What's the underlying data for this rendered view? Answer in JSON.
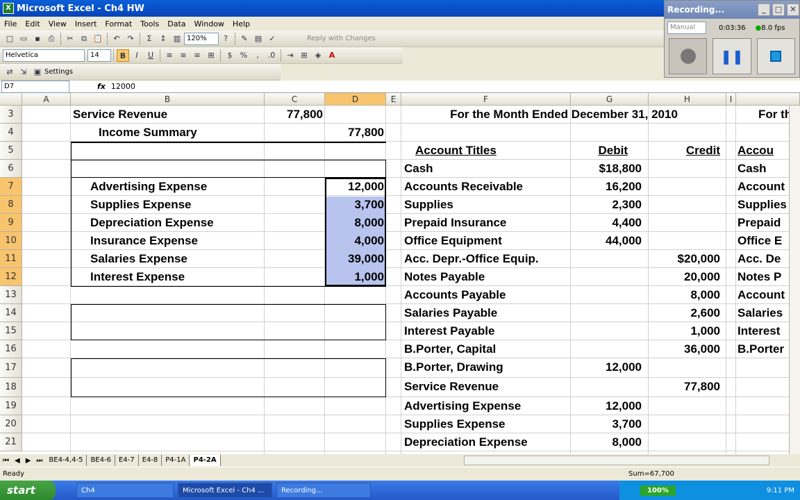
{
  "window": {
    "title": "Microsoft Excel - Ch4 HW"
  },
  "menu": [
    "File",
    "Edit",
    "View",
    "Insert",
    "Format",
    "Tools",
    "Data",
    "Window",
    "Help"
  ],
  "toolbar": {
    "zoom": "120%",
    "reply_label": "Reply with Changes",
    "font": "Helvetica",
    "font_size": "14",
    "settings_label": "Settings"
  },
  "recorder": {
    "title": "Recording...",
    "mode": "Manual",
    "time": "0:03:36",
    "fps": "8.0 fps"
  },
  "formula_bar": {
    "cell_ref": "D7",
    "fx": "fx",
    "value": "12000"
  },
  "columns": [
    "A",
    "B",
    "C",
    "D",
    "E",
    "F",
    "G",
    "H",
    "I"
  ],
  "rows": [
    "3",
    "4",
    "5",
    "6",
    "7",
    "8",
    "9",
    "10",
    "11",
    "12",
    "13",
    "14",
    "15",
    "16",
    "17",
    "18",
    "19",
    "20",
    "21"
  ],
  "left": [
    {
      "b": "Service Revenue",
      "c": "77,800",
      "d": ""
    },
    {
      "b": "Income Summary",
      "c": "",
      "d": "77,800"
    },
    {
      "b": "",
      "c": "",
      "d": ""
    },
    {
      "b": "",
      "c": "",
      "d": ""
    },
    {
      "b": "Advertising Expense",
      "c": "",
      "d": "12,000"
    },
    {
      "b": "Supplies Expense",
      "c": "",
      "d": "3,700"
    },
    {
      "b": "Depreciation Expense",
      "c": "",
      "d": "8,000"
    },
    {
      "b": "Insurance Expense",
      "c": "",
      "d": "4,000"
    },
    {
      "b": "Salaries Expense",
      "c": "",
      "d": "39,000"
    },
    {
      "b": "Interest Expense",
      "c": "",
      "d": "1,000"
    }
  ],
  "right": [
    {
      "f": "For the Month Ended December 31, 2010",
      "g": "",
      "h": "",
      "i": "For th"
    },
    {
      "f": "",
      "g": "",
      "h": "",
      "i": ""
    },
    {
      "f": "Account Titles",
      "g": "Debit",
      "h": "Credit",
      "i": "Accou"
    },
    {
      "f": "Cash",
      "g": "$18,800",
      "h": "",
      "i": "Cash"
    },
    {
      "f": "Accounts Receivable",
      "g": "16,200",
      "h": "",
      "i": "Account"
    },
    {
      "f": "Supplies",
      "g": "2,300",
      "h": "",
      "i": "Supplies"
    },
    {
      "f": "Prepaid Insurance",
      "g": "4,400",
      "h": "",
      "i": "Prepaid"
    },
    {
      "f": "Office Equipment",
      "g": "44,000",
      "h": "",
      "i": "Office E"
    },
    {
      "f": "Acc. Depr.-Office Equip.",
      "g": "",
      "h": "$20,000",
      "i": "Acc. De"
    },
    {
      "f": "Notes Payable",
      "g": "",
      "h": "20,000",
      "i": "Notes P"
    },
    {
      "f": "Accounts Payable",
      "g": "",
      "h": "8,000",
      "i": "Account"
    },
    {
      "f": "Salaries Payable",
      "g": "",
      "h": "2,600",
      "i": "Salaries"
    },
    {
      "f": "Interest Payable",
      "g": "",
      "h": "1,000",
      "i": "Interest"
    },
    {
      "f": "B.Porter, Capital",
      "g": "",
      "h": "36,000",
      "i": "B.Porter"
    },
    {
      "f": "B.Porter, Drawing",
      "g": "12,000",
      "h": "",
      "i": ""
    },
    {
      "f": "Service Revenue",
      "g": "",
      "h": "77,800",
      "i": ""
    },
    {
      "f": "Advertising Expense",
      "g": "12,000",
      "h": "",
      "i": ""
    },
    {
      "f": "Supplies Expense",
      "g": "3,700",
      "h": "",
      "i": ""
    },
    {
      "f": "Depreciation Expense",
      "g": "8,000",
      "h": "",
      "i": ""
    }
  ],
  "sheets": [
    "BE4-4,4-5",
    "BE4-6",
    "E4-7",
    "E4-8",
    "P4-1A",
    "P4-2A"
  ],
  "status": {
    "ready": "Ready",
    "sum": "Sum=67,700"
  },
  "taskbar": {
    "start": "start",
    "tasks": [
      "Ch4",
      "Microsoft Excel - Ch4 ...",
      "Recording..."
    ],
    "zoom_badge": "100%",
    "time": "9:11 PM"
  }
}
